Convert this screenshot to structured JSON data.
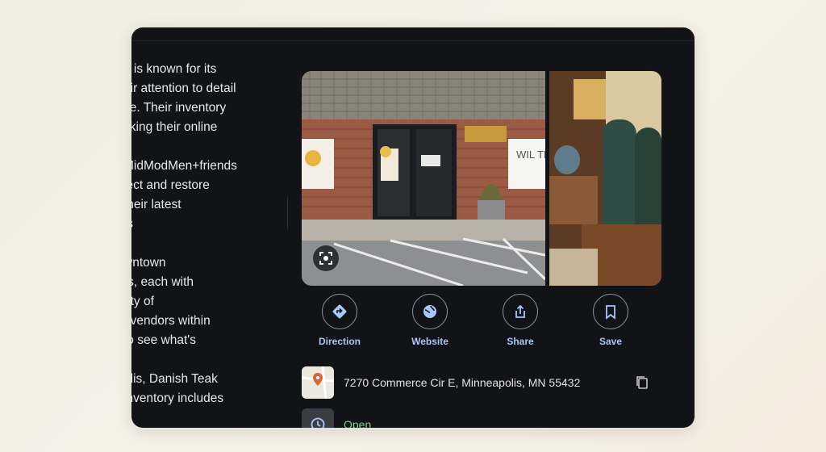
{
  "description_lines": [
    "n is known for its",
    "eir attention to detail",
    "ce. Their inventory",
    "cking their online",
    "",
    "MidModMen+friends",
    "lect and restore",
    " their latest",
    "ts",
    "",
    "wntown",
    "rs, each with",
    "ety of",
    "t vendors within",
    "to see what's",
    "",
    "olis, Danish Teak",
    "inventory includes"
  ],
  "storefront_sign": "WIL THIN",
  "actions": [
    {
      "label": "Direction",
      "icon": "directions-icon"
    },
    {
      "label": "Website",
      "icon": "globe-icon"
    },
    {
      "label": "Share",
      "icon": "share-icon"
    },
    {
      "label": "Save",
      "icon": "bookmark-icon"
    }
  ],
  "address": "7270 Commerce Cir E, Minneapolis, MN 55432",
  "hours_status": "Open",
  "colors": {
    "panel_bg": "#111317",
    "accent": "#a8c7fa",
    "open_green": "#7fcf8c"
  }
}
